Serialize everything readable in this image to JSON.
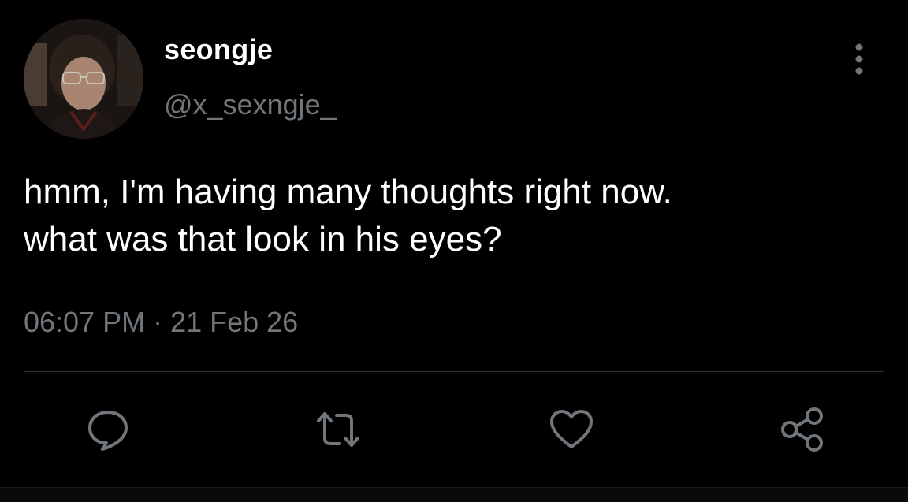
{
  "tweet": {
    "display_name": "seongje",
    "handle": "@x_sexngje_",
    "text": "hmm, I'm having many thoughts right now.\nwhat was that look in his eyes?",
    "timestamp": "06:07 PM · 21 Feb 26"
  },
  "actions": [
    {
      "icon": "reply-icon"
    },
    {
      "icon": "retweet-icon"
    },
    {
      "icon": "like-icon"
    },
    {
      "icon": "share-icon"
    }
  ],
  "colors": {
    "background": "#000000",
    "primary_text": "#ffffff",
    "secondary_text": "#71767b",
    "divider": "#2f3336",
    "icon": "#71767b"
  }
}
